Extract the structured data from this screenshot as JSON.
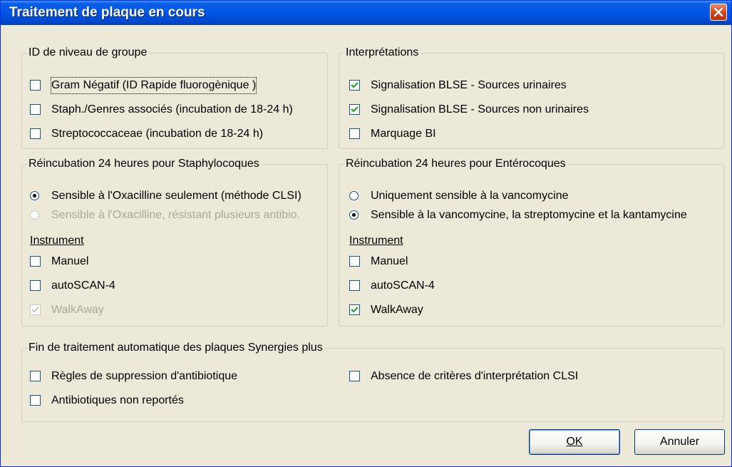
{
  "window": {
    "title": "Traitement de plaque en cours"
  },
  "group_id": {
    "legend": "ID de niveau de groupe",
    "items": [
      {
        "label": "Gram Négatif (ID Rapide fluorogènique )",
        "checked": false
      },
      {
        "label": "Staph./Genres associés (incubation de 18-24 h)",
        "checked": false
      },
      {
        "label": "Streptococcaceae (incubation de 18-24 h)",
        "checked": false
      }
    ]
  },
  "interpretations": {
    "legend": "Interprétations",
    "items": [
      {
        "label": "Signalisation BLSE - Sources urinaires",
        "checked": true
      },
      {
        "label": "Signalisation BLSE - Sources non urinaires",
        "checked": true
      },
      {
        "label": "Marquage BI",
        "checked": false
      }
    ]
  },
  "staph": {
    "legend": "Réincubation 24 heures pour Staphylocoques",
    "options": [
      {
        "label": "Sensible à l'Oxacilline seulement (méthode CLSI)",
        "selected": true,
        "enabled": true
      },
      {
        "label": "Sensible à l'Oxacilline, résistant plusieurs antibio.",
        "selected": false,
        "enabled": false
      }
    ],
    "instrument_label": "Instrument",
    "instruments": [
      {
        "label": "Manuel",
        "checked": false,
        "enabled": true
      },
      {
        "label": "autoSCAN-4",
        "checked": false,
        "enabled": true
      },
      {
        "label": "WalkAway",
        "checked": true,
        "enabled": false
      }
    ]
  },
  "entero": {
    "legend": "Réincubation 24 heures pour Entérocoques",
    "options": [
      {
        "label": "Uniquement sensible à la vancomycine",
        "selected": false,
        "enabled": true
      },
      {
        "label": "Sensible à la vancomycine, la streptomycine et la kantamycine",
        "selected": true,
        "enabled": true
      }
    ],
    "instrument_label": "Instrument",
    "instruments": [
      {
        "label": "Manuel",
        "checked": false,
        "enabled": true
      },
      {
        "label": "autoSCAN-4",
        "checked": false,
        "enabled": true
      },
      {
        "label": "WalkAway",
        "checked": true,
        "enabled": true
      }
    ]
  },
  "auto_end": {
    "legend": "Fin de traitement automatique des plaques Synergies plus",
    "items": [
      {
        "label": "Règles de suppression d'antibiotique",
        "checked": false
      },
      {
        "label": "Antibiotiques non reportés",
        "checked": false
      },
      {
        "label": "Absence de critères d'interprétation CLSI",
        "checked": false
      }
    ]
  },
  "buttons": {
    "ok_label": "OK",
    "cancel_label": "Annuler"
  },
  "colors": {
    "titlebar": "#0054e3",
    "dialog_bg": "#ece9d8",
    "close_button": "#d14416",
    "disabled_text": "#aca899"
  }
}
